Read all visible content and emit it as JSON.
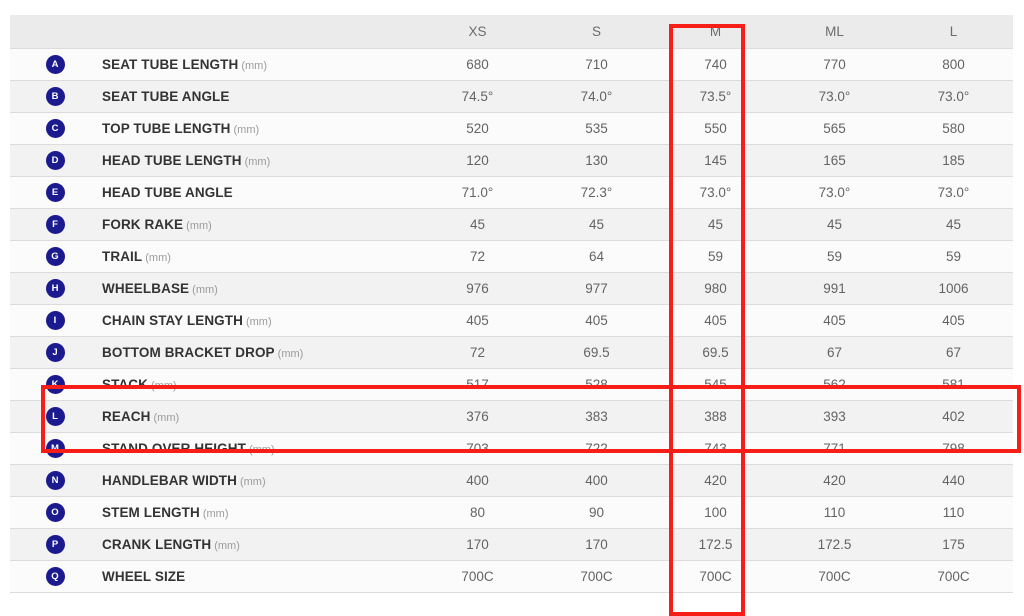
{
  "table": {
    "name": "bicycle-geometry-table",
    "corner_headers": [
      "",
      ""
    ],
    "size_headers": [
      "XS",
      "S",
      "M",
      "ML",
      "L"
    ],
    "highlight_color": "#f81e18",
    "badge_color": "#1b1b8f",
    "highlighted_size_column": "M",
    "highlighted_rows": [
      "STACK",
      "REACH"
    ],
    "rows": [
      {
        "badge": "A",
        "label": "SEAT TUBE LENGTH",
        "unit": "(mm)",
        "values": [
          "680",
          "710",
          "740",
          "770",
          "800"
        ]
      },
      {
        "badge": "B",
        "label": "SEAT TUBE ANGLE",
        "unit": "",
        "values": [
          "74.5°",
          "74.0°",
          "73.5°",
          "73.0°",
          "73.0°"
        ]
      },
      {
        "badge": "C",
        "label": "TOP TUBE LENGTH",
        "unit": "(mm)",
        "values": [
          "520",
          "535",
          "550",
          "565",
          "580"
        ]
      },
      {
        "badge": "D",
        "label": "HEAD TUBE LENGTH",
        "unit": "(mm)",
        "values": [
          "120",
          "130",
          "145",
          "165",
          "185"
        ]
      },
      {
        "badge": "E",
        "label": "HEAD TUBE ANGLE",
        "unit": "",
        "values": [
          "71.0°",
          "72.3°",
          "73.0°",
          "73.0°",
          "73.0°"
        ]
      },
      {
        "badge": "F",
        "label": "FORK RAKE",
        "unit": "(mm)",
        "values": [
          "45",
          "45",
          "45",
          "45",
          "45"
        ]
      },
      {
        "badge": "G",
        "label": "TRAIL",
        "unit": "(mm)",
        "values": [
          "72",
          "64",
          "59",
          "59",
          "59"
        ]
      },
      {
        "badge": "H",
        "label": "WHEELBASE",
        "unit": "(mm)",
        "values": [
          "976",
          "977",
          "980",
          "991",
          "1006"
        ]
      },
      {
        "badge": "I",
        "label": "CHAIN STAY LENGTH",
        "unit": "(mm)",
        "values": [
          "405",
          "405",
          "405",
          "405",
          "405"
        ]
      },
      {
        "badge": "J",
        "label": "BOTTOM BRACKET DROP",
        "unit": "(mm)",
        "values": [
          "72",
          "69.5",
          "69.5",
          "67",
          "67"
        ]
      },
      {
        "badge": "K",
        "label": "STACK",
        "unit": "(mm)",
        "values": [
          "517",
          "528",
          "545",
          "562",
          "581"
        ]
      },
      {
        "badge": "L",
        "label": "REACH",
        "unit": "(mm)",
        "values": [
          "376",
          "383",
          "388",
          "393",
          "402"
        ]
      },
      {
        "badge": "M",
        "label": "STAND OVER HEIGHT",
        "unit": "(mm)",
        "values": [
          "703",
          "722",
          "743",
          "771",
          "798"
        ]
      },
      {
        "badge": "N",
        "label": "HANDLEBAR WIDTH",
        "unit": "(mm)",
        "values": [
          "400",
          "400",
          "420",
          "420",
          "440"
        ]
      },
      {
        "badge": "O",
        "label": "STEM LENGTH",
        "unit": "(mm)",
        "values": [
          "80",
          "90",
          "100",
          "110",
          "110"
        ]
      },
      {
        "badge": "P",
        "label": "CRANK LENGTH",
        "unit": "(mm)",
        "values": [
          "170",
          "170",
          "172.5",
          "172.5",
          "175"
        ]
      },
      {
        "badge": "Q",
        "label": "WHEEL SIZE",
        "unit": "",
        "values": [
          "700C",
          "700C",
          "700C",
          "700C",
          "700C"
        ]
      }
    ]
  }
}
